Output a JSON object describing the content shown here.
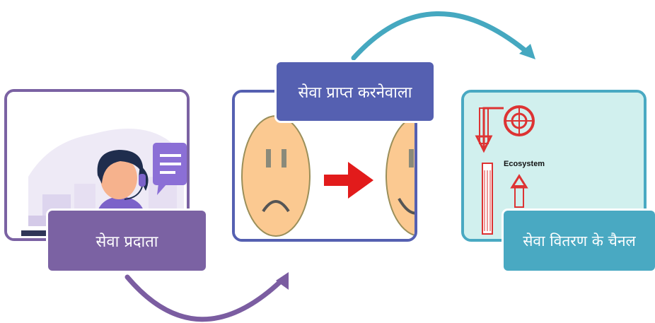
{
  "steps": [
    {
      "label": "सेवा प्रदाता",
      "color": "#7b62a3"
    },
    {
      "label": "सेवा प्राप्त करनेवाला",
      "color": "#5560b1"
    },
    {
      "label": "सेवा वितरण के चैनल",
      "color": "#49a9c2"
    }
  ],
  "ecosystem_text": "Ecosystem",
  "icons": [
    "call-center-agent-icon",
    "sad-face-icon",
    "red-arrow-icon",
    "happy-face-icon",
    "ecosystem-factory-icon"
  ],
  "arrow_colors": {
    "top": "#45a8c0",
    "bottom": "#7b5da1"
  }
}
